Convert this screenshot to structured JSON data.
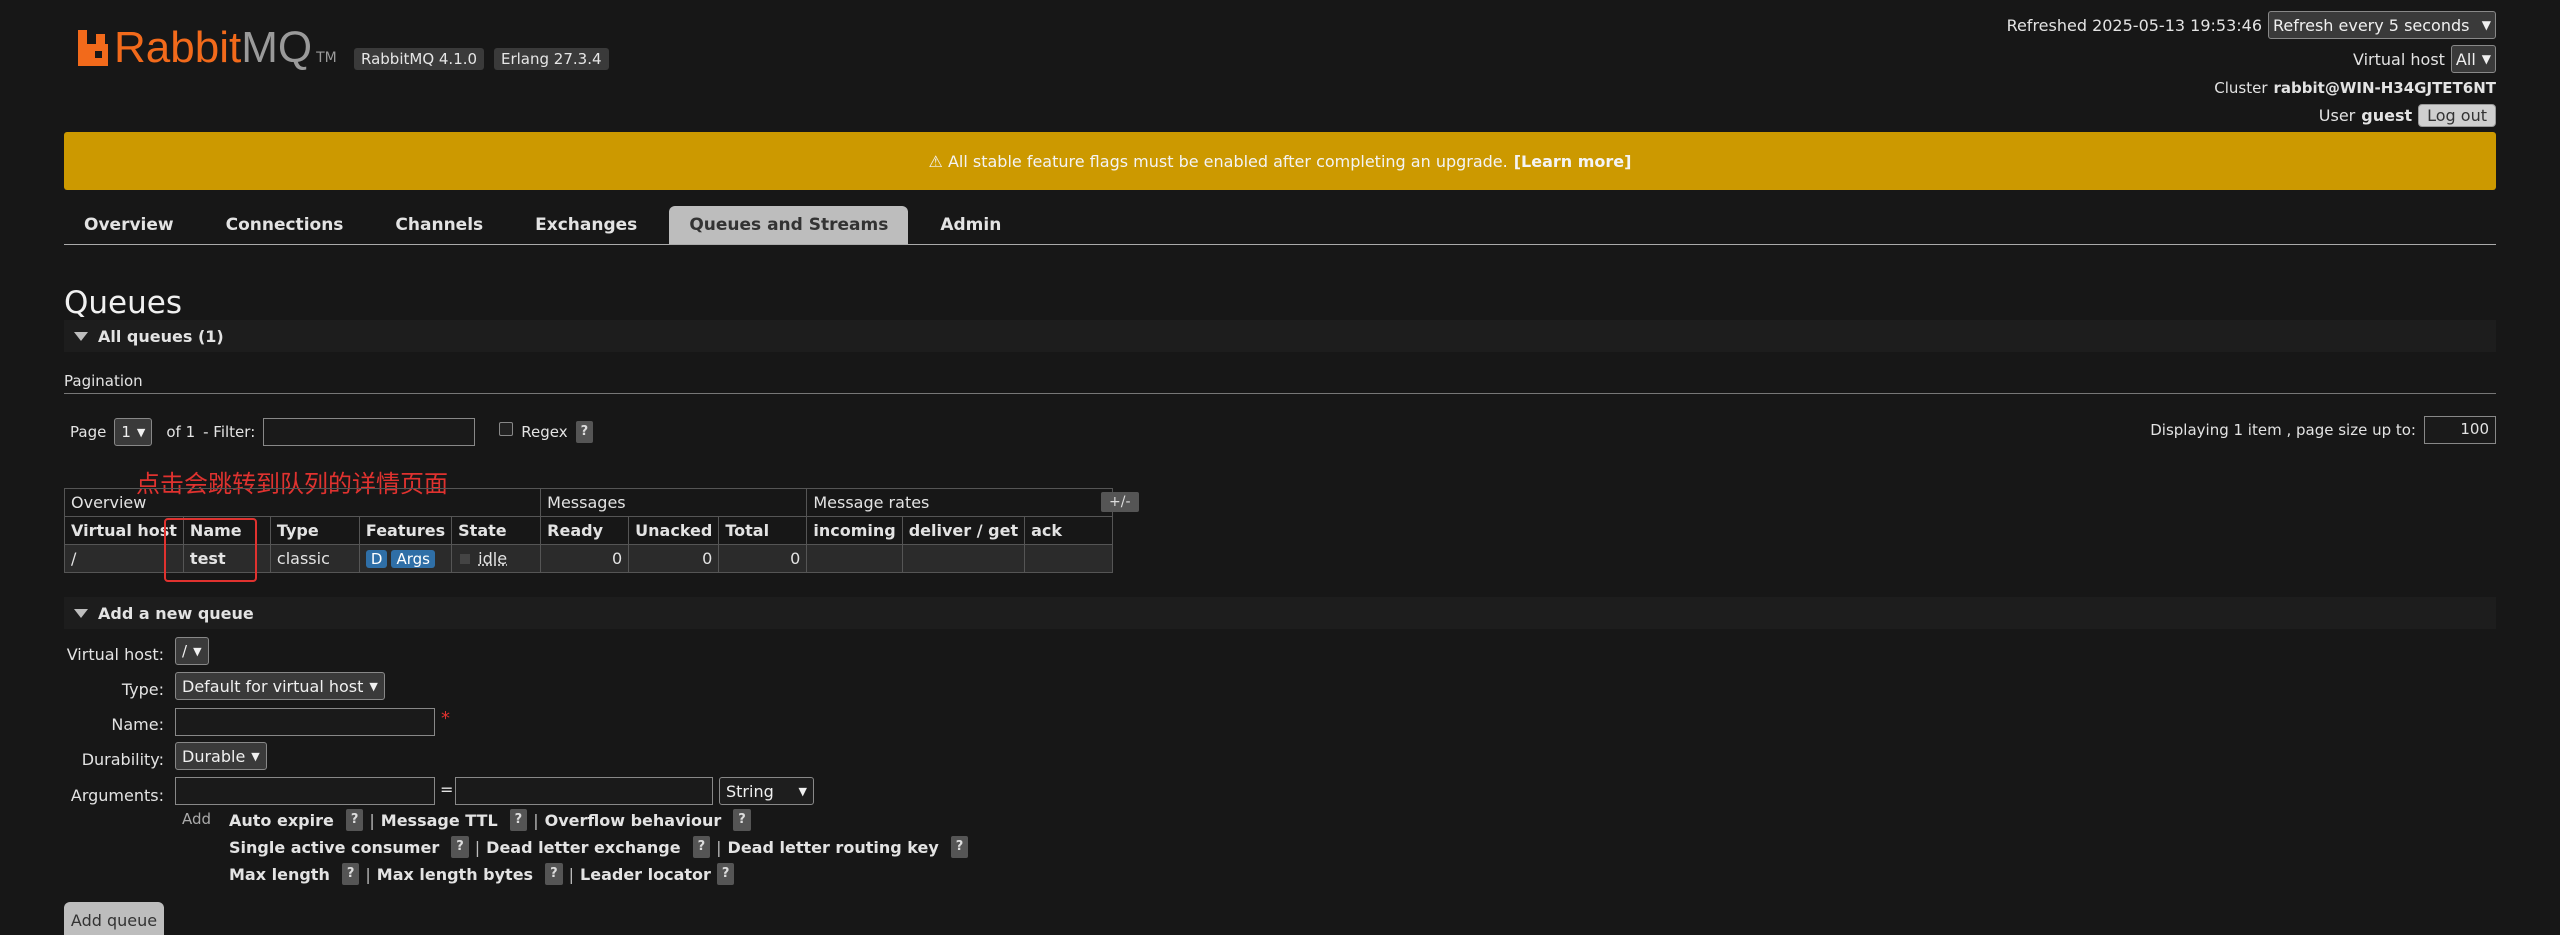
{
  "header": {
    "logo_rabbit": "Rabbit",
    "logo_mq": "MQ",
    "logo_tm": "TM",
    "version_rabbit": "RabbitMQ 4.1.0",
    "version_erlang": "Erlang 27.3.4",
    "refreshed_label": "Refreshed 2025-05-13 19:53:46",
    "refresh_select": "Refresh every 5 seconds",
    "vhost_label": "Virtual host",
    "vhost_select": "All",
    "cluster_label": "Cluster",
    "cluster_value": "rabbit@WIN-H34GJTET6NT",
    "user_label": "User",
    "user_value": "guest",
    "logout": "Log out"
  },
  "banner": {
    "text": "⚠ All stable feature flags must be enabled after completing an upgrade.",
    "link": "[Learn more]"
  },
  "tabs": [
    {
      "label": "Overview",
      "active": false
    },
    {
      "label": "Connections",
      "active": false
    },
    {
      "label": "Channels",
      "active": false
    },
    {
      "label": "Exchanges",
      "active": false
    },
    {
      "label": "Queues and Streams",
      "active": true
    },
    {
      "label": "Admin",
      "active": false
    }
  ],
  "page_title": "Queues",
  "all_queues": "All queues (1)",
  "pagination": {
    "head": "Pagination",
    "page_label": "Page",
    "page_value": "1",
    "of": "of 1",
    "filter_label": "- Filter:",
    "regex_label": "Regex",
    "qmark": "?",
    "displaying": "Displaying 1 item , page size up to:",
    "page_size": "100"
  },
  "annotation": "点击会跳转到队列的详情页面",
  "table": {
    "groups": [
      "Overview",
      "Messages",
      "Message rates"
    ],
    "plusminus": "+/-",
    "headers": [
      "Virtual host",
      "Name",
      "Type",
      "Features",
      "State",
      "Ready",
      "Unacked",
      "Total",
      "incoming",
      "deliver / get",
      "ack"
    ],
    "row": {
      "vhost": "/",
      "name": "test",
      "type": "classic",
      "feature_d": "D",
      "feature_args": "Args",
      "state": "idle",
      "ready": "0",
      "unacked": "0",
      "total": "0",
      "incoming": "",
      "deliver_get": "",
      "ack": ""
    }
  },
  "add_queue": {
    "head": "Add a new queue",
    "vhost_label": "Virtual host:",
    "vhost_value": "/",
    "type_label": "Type:",
    "type_value": "Default for virtual host",
    "name_label": "Name:",
    "required": "*",
    "durability_label": "Durability:",
    "durability_value": "Durable",
    "arguments_label": "Arguments:",
    "equals": "=",
    "arg_type": "String",
    "add_label": "Add",
    "args_row1": [
      "Auto expire",
      "Message TTL",
      "Overflow behaviour"
    ],
    "args_row2": [
      "Single active consumer",
      "Dead letter exchange",
      "Dead letter routing key"
    ],
    "args_row3": [
      "Max length",
      "Max length bytes",
      "Leader locator"
    ],
    "sep": "|",
    "button": "Add queue"
  }
}
